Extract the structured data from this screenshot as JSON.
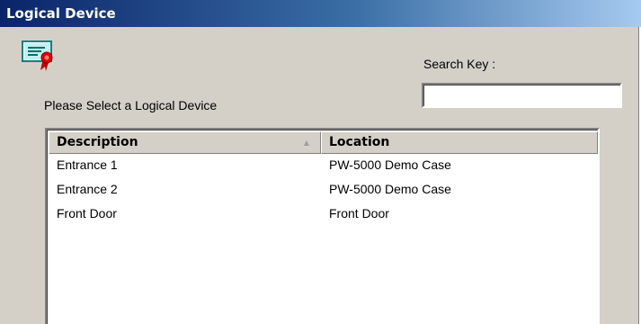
{
  "window": {
    "title": "Logical Device"
  },
  "icons": {
    "header_icon": "certificate-icon"
  },
  "search": {
    "label": "Search Key :",
    "value": "",
    "placeholder": ""
  },
  "prompt": "Please Select a Logical Device",
  "list": {
    "columns": [
      {
        "label": "Description",
        "sorted": true
      },
      {
        "label": "Location",
        "sorted": false
      }
    ],
    "rows": [
      {
        "description": "Entrance 1",
        "location": "PW-5000 Demo Case"
      },
      {
        "description": "Entrance 2",
        "location": "PW-5000 Demo Case"
      },
      {
        "description": "Front Door",
        "location": "Front Door"
      }
    ]
  },
  "colors": {
    "title_gradient_start": "#0a246a",
    "title_gradient_end": "#a6caf0",
    "dialog_bg": "#d4d0c8"
  }
}
